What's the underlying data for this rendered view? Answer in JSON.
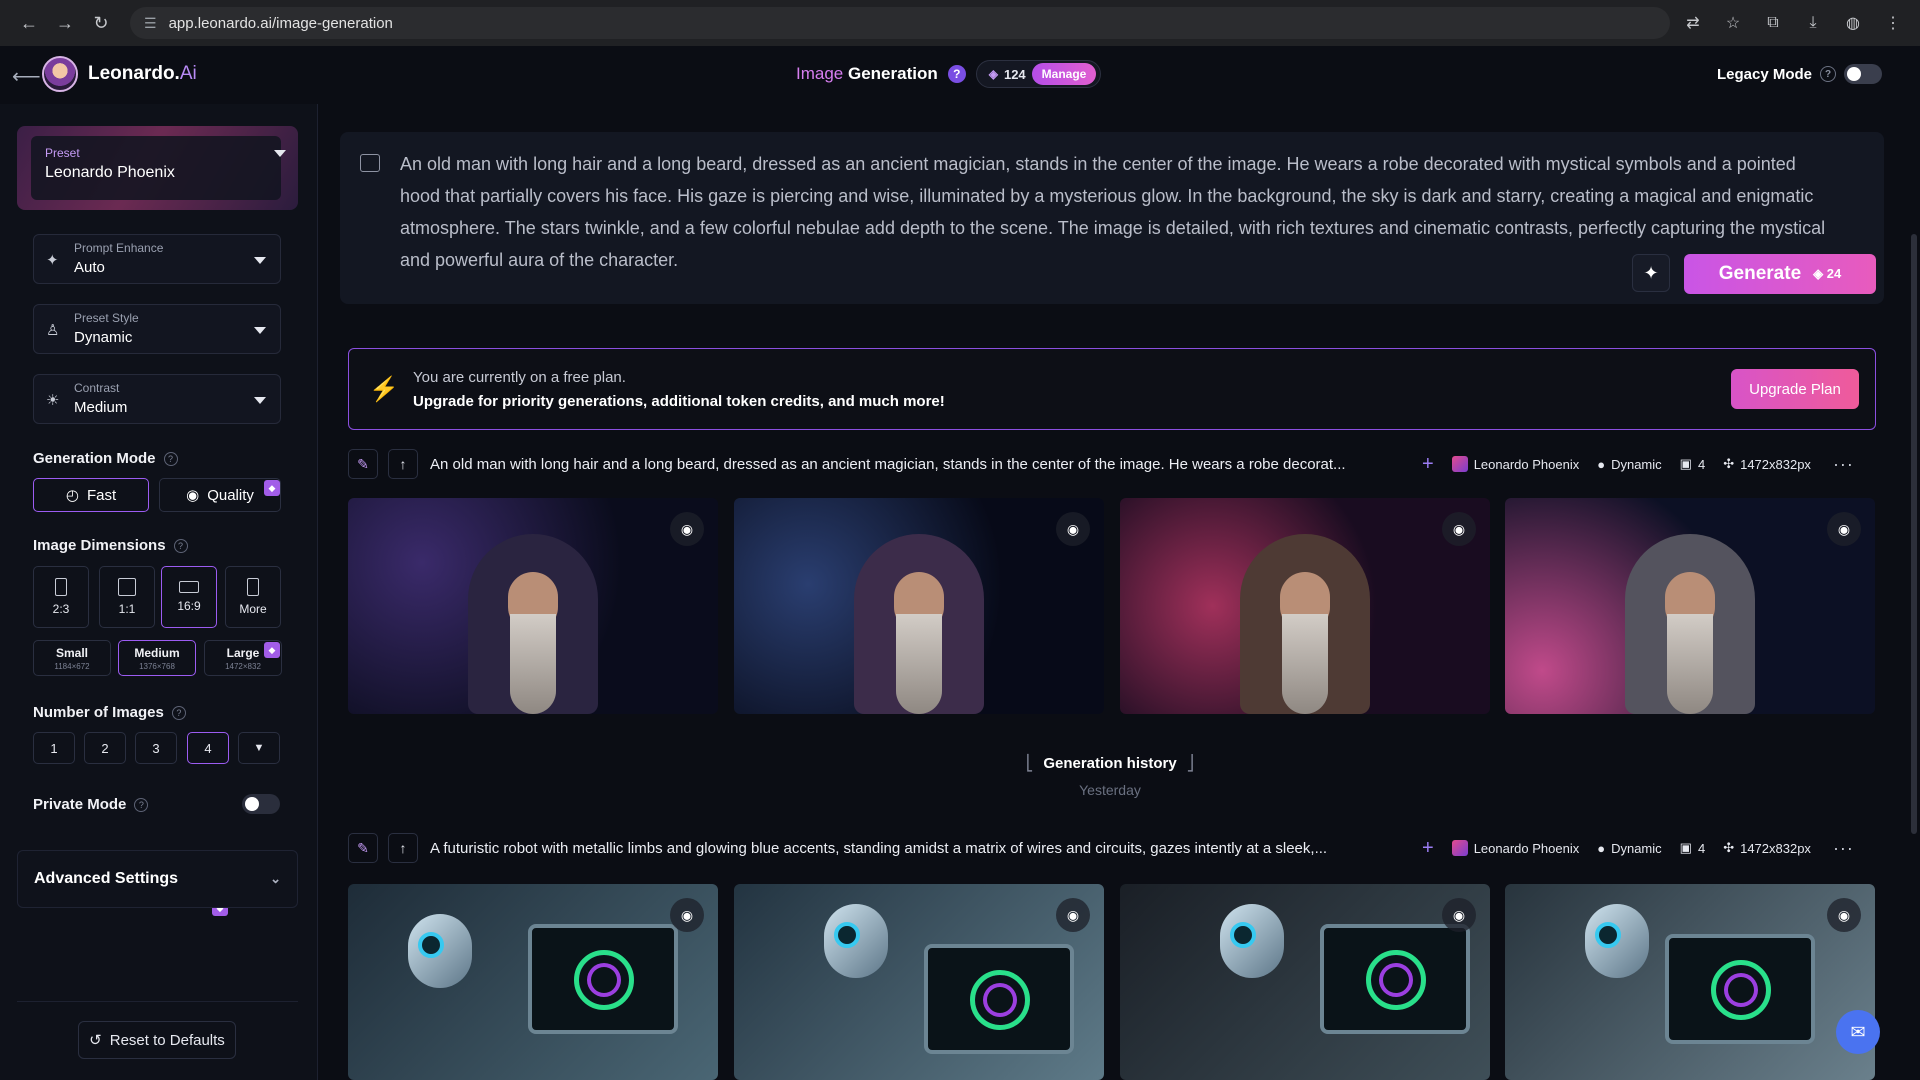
{
  "browser": {
    "url": "app.leonardo.ai/image-generation"
  },
  "header": {
    "logo_text": "Leonardo.",
    "logo_suffix": "Ai",
    "title_part1": "Image",
    "title_part2": "Generation",
    "help": "?",
    "tokens": "124",
    "manage_label": "Manage",
    "legacy_label": "Legacy Mode"
  },
  "sidebar": {
    "preset_label": "Preset",
    "preset_value": "Leonardo Phoenix",
    "prompt_enhance_label": "Prompt Enhance",
    "prompt_enhance_value": "Auto",
    "preset_style_label": "Preset Style",
    "preset_style_value": "Dynamic",
    "contrast_label": "Contrast",
    "contrast_value": "Medium",
    "generation_mode_title": "Generation Mode",
    "mode_fast": "Fast",
    "mode_quality": "Quality",
    "image_dimensions_title": "Image Dimensions",
    "ratios": [
      "2:3",
      "1:1",
      "16:9",
      "More"
    ],
    "sizes": [
      {
        "label": "Small",
        "px": "1184×672"
      },
      {
        "label": "Medium",
        "px": "1376×768"
      },
      {
        "label": "Large",
        "px": "1472×832"
      }
    ],
    "number_of_images_title": "Number of Images",
    "numbers": [
      "1",
      "2",
      "3",
      "4"
    ],
    "private_mode_title": "Private Mode",
    "advanced_settings": "Advanced Settings",
    "reset_label": "Reset to Defaults"
  },
  "prompt": {
    "text": "An old man with long hair and a long beard, dressed as an ancient magician, stands in the center of the image. He wears a robe decorated with mystical symbols and a pointed hood that partially covers his face. His gaze is piercing and wise, illuminated by a mysterious glow. In the background, the sky is dark and starry, creating a magical and enigmatic atmosphere. The stars twinkle, and a few colorful nebulae add depth to the scene. The image is detailed, with rich textures and cinematic contrasts, perfectly capturing the mystical and powerful aura of the character.",
    "generate_label": "Generate",
    "generate_cost": "24"
  },
  "banner": {
    "line1": "You are currently on a free plan.",
    "line2": "Upgrade for priority generations, additional token credits, and much more!",
    "button": "Upgrade Plan"
  },
  "generations": [
    {
      "prompt": "An old man with long hair and a long beard, dressed as an ancient magician, stands in the center of the image. He wears a robe decorat...",
      "model": "Leonardo Phoenix",
      "style": "Dynamic",
      "count": "4",
      "dims": "1472x832px"
    },
    {
      "prompt": "A futuristic robot with metallic limbs and glowing blue accents, standing amidst a matrix of wires and circuits, gazes intently at a sleek,...",
      "model": "Leonardo Phoenix",
      "style": "Dynamic",
      "count": "4",
      "dims": "1472x832px"
    }
  ],
  "history": {
    "title": "Generation history",
    "sub": "Yesterday"
  },
  "colors": {
    "accent": "#9c5cf2",
    "generate_gradient_start": "#c955e6",
    "generate_gradient_end": "#e85bbd",
    "background": "#0b0d14"
  }
}
